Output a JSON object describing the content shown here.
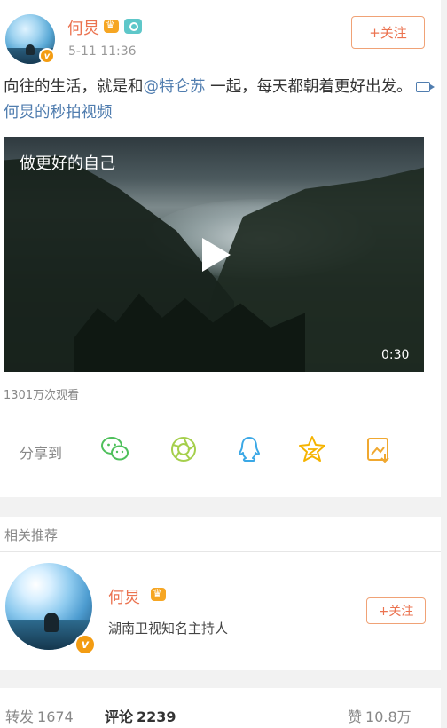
{
  "post": {
    "author_name": "何炅",
    "timestamp": "5-11 11:36",
    "follow_label": "+关注",
    "text_before_mention": "向往的生活，就是和",
    "mention": "@特仑苏",
    "text_after_mention": " 一起，每天都朝着更好出发。",
    "video_link_text": "何炅的秒拍视频"
  },
  "video": {
    "caption": "做更好的自己",
    "duration": "0:30",
    "view_count": "1301万次观看"
  },
  "share": {
    "label": "分享到",
    "icons": [
      "wechat-icon",
      "moments-icon",
      "qq-icon",
      "qzone-icon",
      "save-image-icon"
    ]
  },
  "recommend": {
    "section_label": "相关推荐",
    "name": "何炅",
    "description": "湖南卫视知名主持人",
    "follow_label": "+关注"
  },
  "stats": {
    "repost_label": "转发",
    "repost_count": "1674",
    "comment_label": "评论",
    "comment_count": "2239",
    "like_label": "赞",
    "like_count": "10.8万"
  },
  "colors": {
    "accent_orange": "#eb7350",
    "link_blue": "#507daf",
    "badge_gold": "#f39c12"
  }
}
